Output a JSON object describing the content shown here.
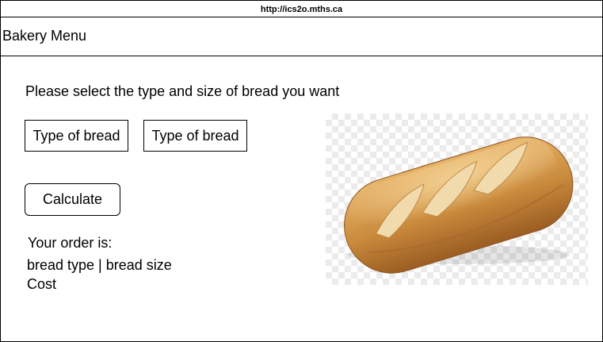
{
  "browser": {
    "url": "http://ics2o.mths.ca"
  },
  "header": {
    "title": "Bakery Menu"
  },
  "main": {
    "prompt": "Please select the type and size of bread you want",
    "type_select": {
      "selected": "Type of bread"
    },
    "size_select": {
      "selected": "Type of bread"
    },
    "calculate_label": "Calculate",
    "order_label": "Your order is:",
    "order_summary": "bread type | bread size",
    "cost_label": "Cost"
  },
  "image": {
    "subject": "bread-loaf-image",
    "background": "transparency-checkerboard"
  },
  "colors": {
    "border": "#000000",
    "crust_dark": "#b8732a",
    "crust_light": "#e6b266",
    "crumb": "#f3e1b8"
  }
}
